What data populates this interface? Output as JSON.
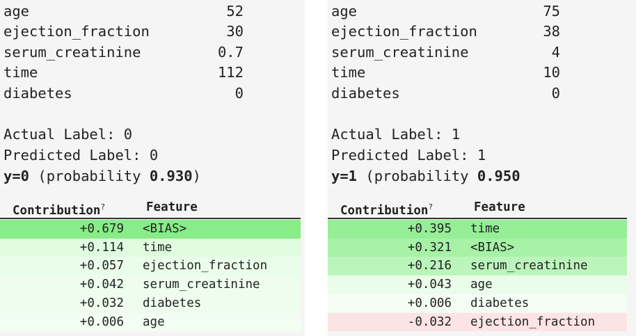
{
  "left": {
    "features": [
      {
        "name": "age",
        "value": "52"
      },
      {
        "name": "ejection_fraction",
        "value": "30"
      },
      {
        "name": "serum_creatinine",
        "value": "0.7"
      },
      {
        "name": "time",
        "value": "112"
      },
      {
        "name": "diabetes",
        "value": "0"
      }
    ],
    "actual_label": "Actual Label: 0",
    "predicted_label": "Predicted Label: 0",
    "prediction": {
      "y": "y=0",
      "prob_prefix": " (probability ",
      "prob": "0.930",
      "prob_suffix": ")"
    },
    "table": {
      "header_contribution": "Contribution",
      "header_contribution_mark": "?",
      "header_feature": "Feature",
      "rows": [
        {
          "contribution": "+0.679",
          "feature": "<BIAS>",
          "color": "#88ec88"
        },
        {
          "contribution": "+0.114",
          "feature": "time",
          "color": "#e0fce0"
        },
        {
          "contribution": "+0.057",
          "feature": "ejection_fraction",
          "color": "#eafdea"
        },
        {
          "contribution": "+0.042",
          "feature": "serum_creatinine",
          "color": "#eefdee"
        },
        {
          "contribution": "+0.032",
          "feature": "diabetes",
          "color": "#effdef"
        },
        {
          "contribution": "+0.006",
          "feature": "age",
          "color": "#f3fef3"
        }
      ]
    }
  },
  "right": {
    "features": [
      {
        "name": "age",
        "value": "75"
      },
      {
        "name": "ejection_fraction",
        "value": "38"
      },
      {
        "name": "serum_creatinine",
        "value": "4"
      },
      {
        "name": "time",
        "value": "10"
      },
      {
        "name": "diabetes",
        "value": "0"
      }
    ],
    "actual_label": "Actual Label: 1",
    "predicted_label": "Predicted Label: 1",
    "prediction": {
      "y": "y=1",
      "prob_prefix": " (probability ",
      "prob": "0.950",
      "prob_suffix": ""
    },
    "table": {
      "header_contribution": "Contribution",
      "header_contribution_mark": "?",
      "header_feature": "Feature",
      "rows": [
        {
          "contribution": "+0.395",
          "feature": "time",
          "color": "#96ee96"
        },
        {
          "contribution": "+0.321",
          "feature": "<BIAS>",
          "color": "#a7f2a7"
        },
        {
          "contribution": "+0.216",
          "feature": "serum_creatinine",
          "color": "#bcf5bc"
        },
        {
          "contribution": "+0.043",
          "feature": "age",
          "color": "#eafdea"
        },
        {
          "contribution": "+0.006",
          "feature": "diabetes",
          "color": "#f5fef5"
        },
        {
          "contribution": "-0.032",
          "feature": "ejection_fraction",
          "color": "#fce4e4"
        }
      ]
    }
  }
}
